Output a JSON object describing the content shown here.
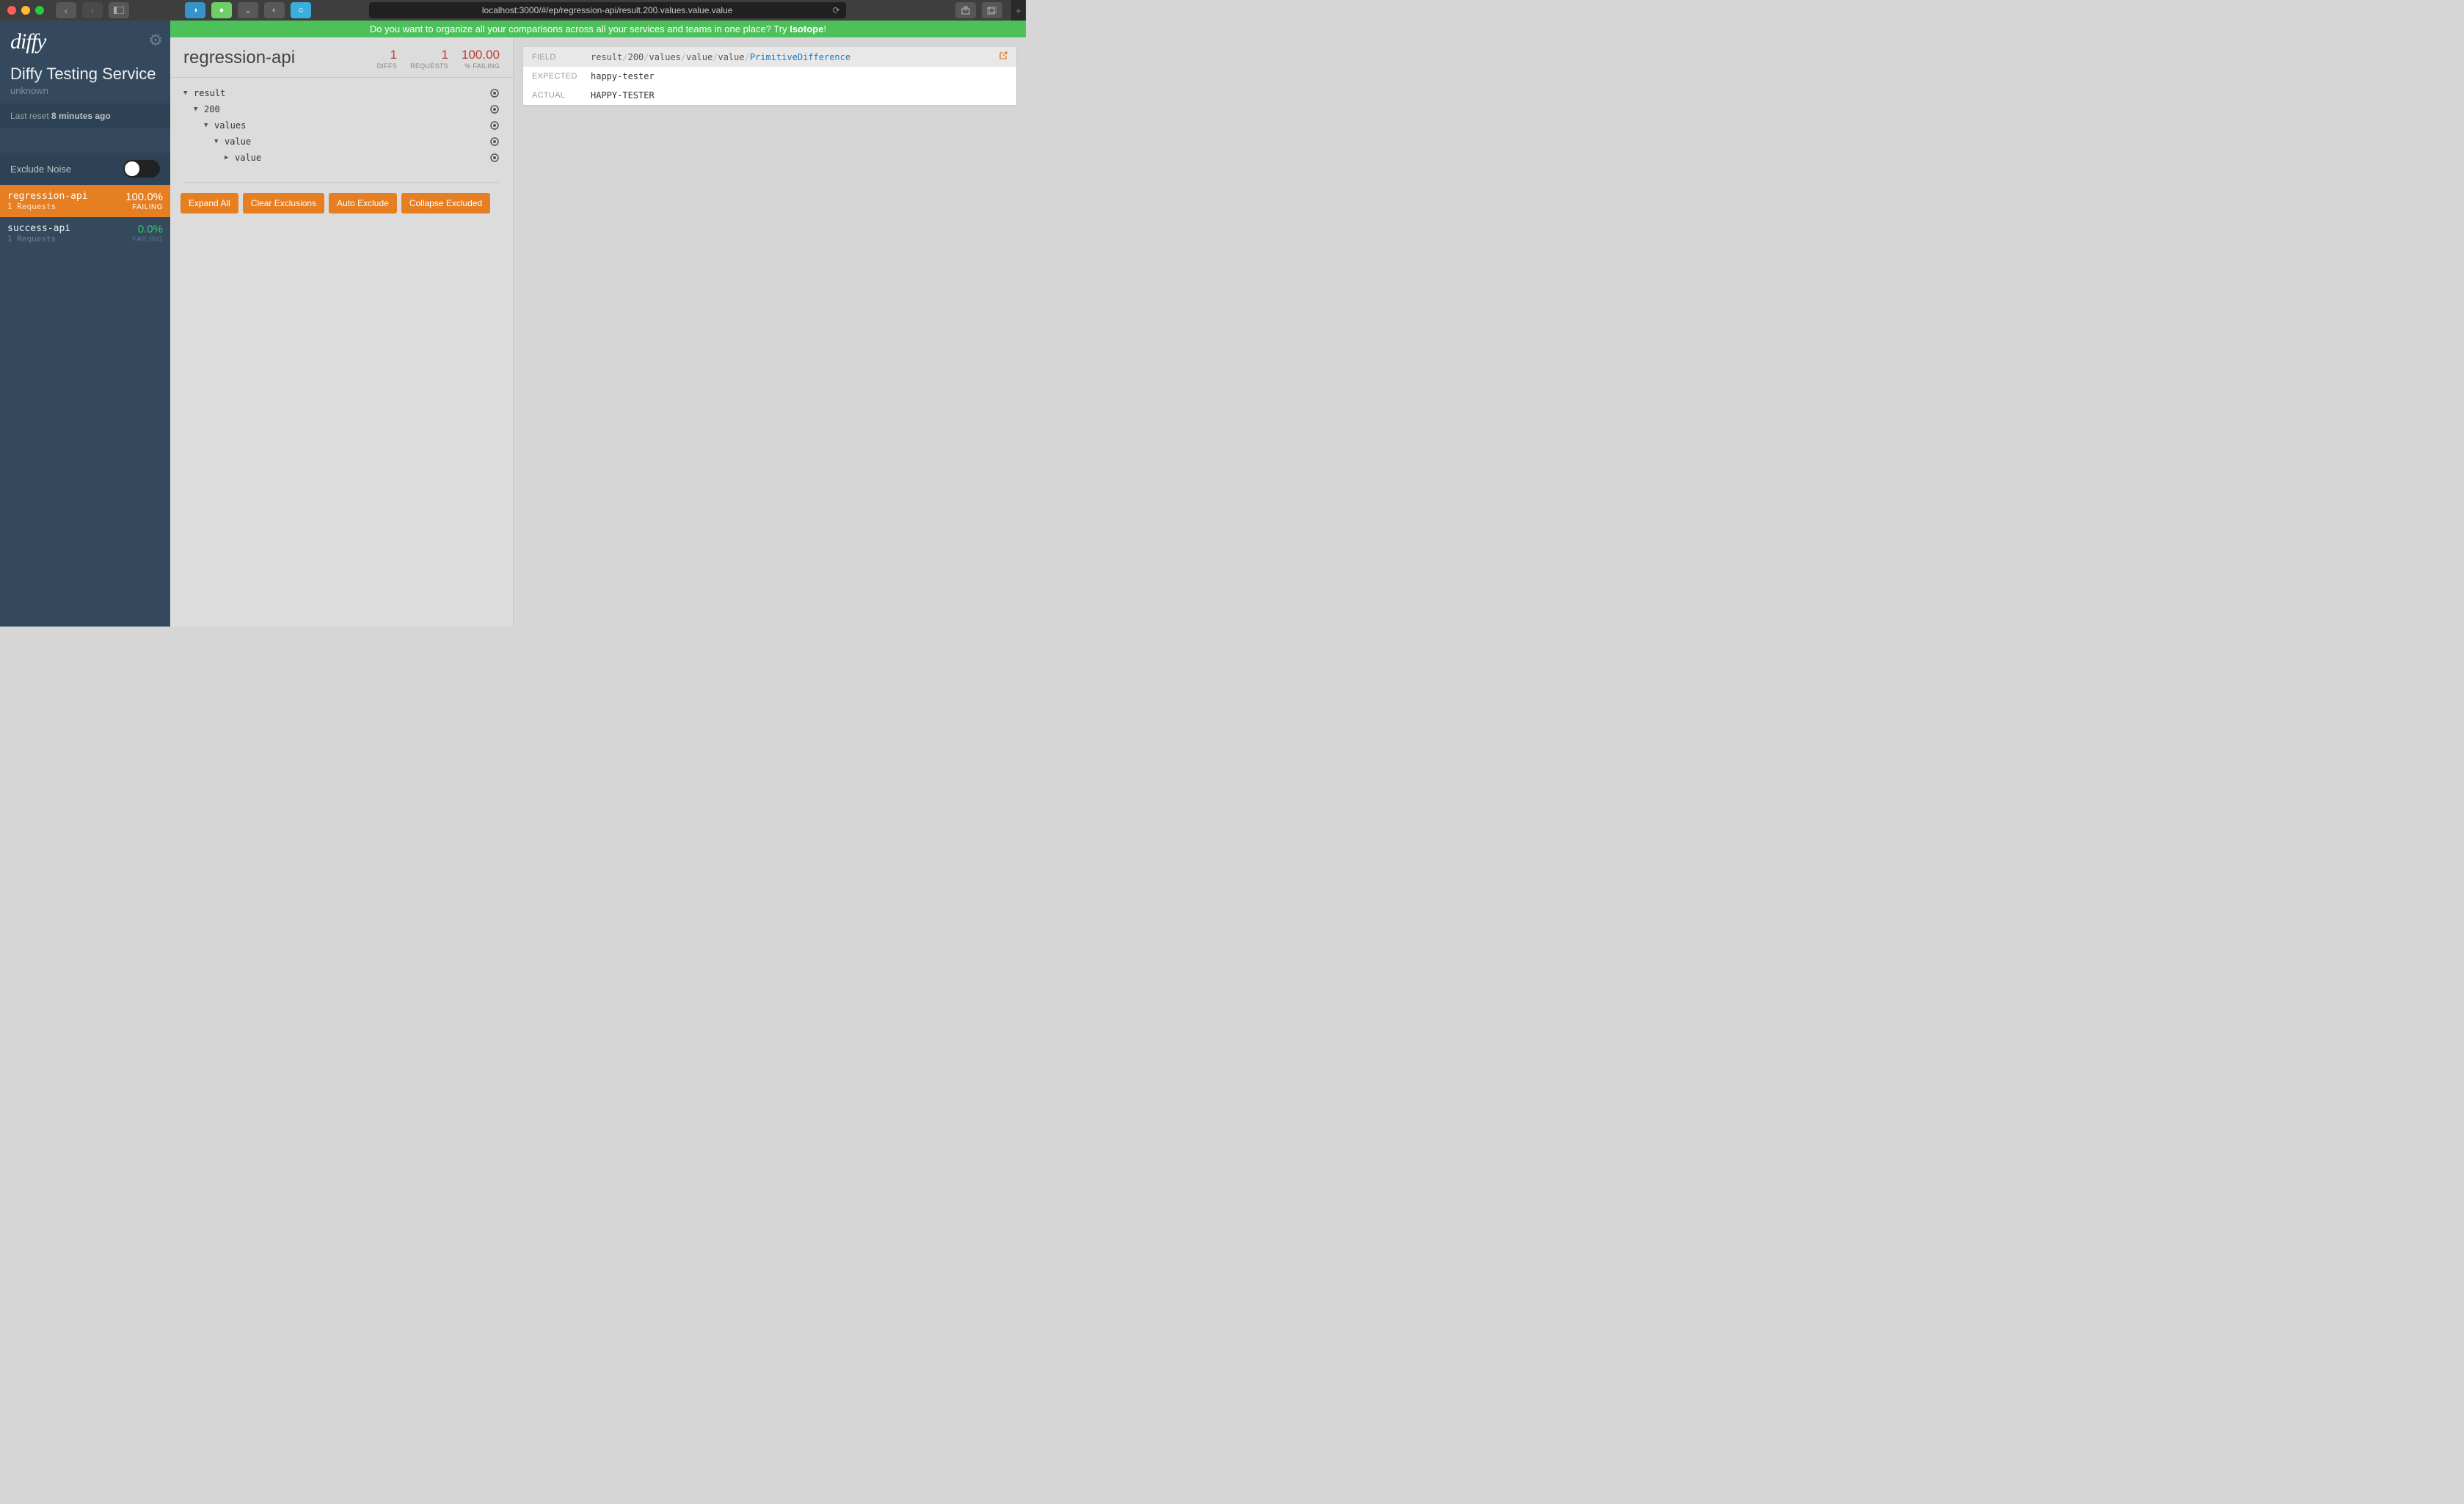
{
  "browser": {
    "url": "localhost:3000/#/ep/regression-api/result.200.values.value.value"
  },
  "banner": {
    "text_prefix": "Do you want to organize all your comparisons across all your services and teams in one place? Try ",
    "link": "Isotope",
    "suffix": "!"
  },
  "sidebar": {
    "logo": "diffy",
    "service_title": "Diffy Testing Service",
    "service_sub": "unknown",
    "last_reset_label": "Last reset ",
    "last_reset_value": "8 minutes ago",
    "exclude_noise_label": "Exclude Noise",
    "endpoints": [
      {
        "name": "regression-api",
        "requests": "1 Requests",
        "pct": "100.0%",
        "fail": "FAILING",
        "active": true
      },
      {
        "name": "success-api",
        "requests": "1 Requests",
        "pct": "0.0%",
        "fail": "FAILING",
        "active": false
      }
    ]
  },
  "endpoint_panel": {
    "title": "regression-api",
    "stats": [
      {
        "value": "1",
        "label": "DIFFS"
      },
      {
        "value": "1",
        "label": "REQUESTS"
      },
      {
        "value": "100.00",
        "label": "% FAILING"
      }
    ],
    "tree": [
      {
        "indent": 0,
        "arrow": "▼",
        "label": "result"
      },
      {
        "indent": 1,
        "arrow": "▼",
        "label": "200"
      },
      {
        "indent": 2,
        "arrow": "▼",
        "label": "values"
      },
      {
        "indent": 3,
        "arrow": "▼",
        "label": "value"
      },
      {
        "indent": 4,
        "arrow": "▶",
        "label": "value"
      }
    ],
    "buttons": {
      "expand": "Expand All",
      "clear": "Clear Exclusions",
      "auto": "Auto Exclude",
      "collapse": "Collapse Excluded"
    }
  },
  "diff_panel": {
    "field_label": "FIELD",
    "field_path": [
      "result",
      "200",
      "values",
      "value",
      "value"
    ],
    "field_type": "PrimitiveDifference",
    "expected_label": "EXPECTED",
    "expected_value": "happy-tester",
    "actual_label": "ACTUAL",
    "actual_value": "HAPPY-TESTER"
  }
}
